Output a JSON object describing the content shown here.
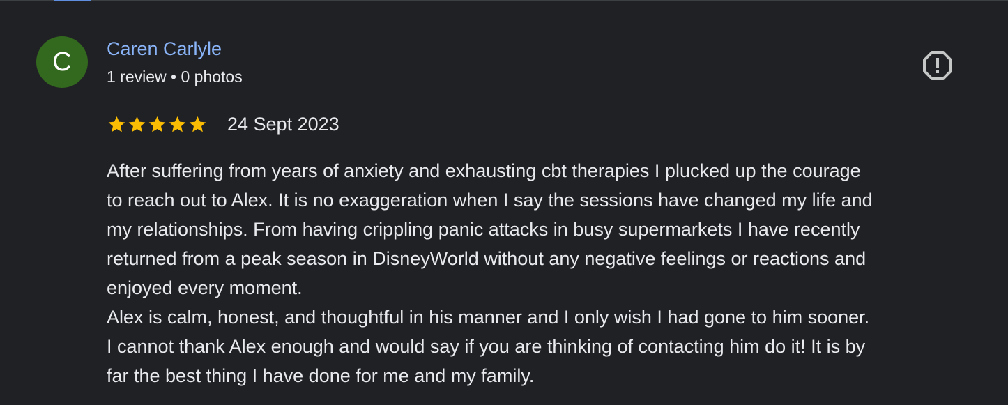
{
  "reviewer": {
    "initial": "C",
    "name": "Caren Carlyle",
    "meta": "1 review • 0 photos",
    "avatar_color": "#33691e"
  },
  "review": {
    "rating": 5,
    "max_rating": 5,
    "date": "24 Sept 2023",
    "lines": [
      "After suffering from years of anxiety and exhausting cbt therapies I plucked up the courage",
      "to reach out to Alex. It is no exaggeration when I say the sessions have changed my life and",
      "my relationships. From having crippling panic attacks in busy supermarkets I have recently",
      "returned from a peak season in DisneyWorld without any negative feelings or reactions and",
      "enjoyed every moment.",
      "Alex is calm, honest, and thoughtful in his manner and I only wish I had gone to him sooner.",
      "I cannot thank Alex enough and would say if you are thinking of contacting him do it! It is by",
      "far the best thing I have done for me and my family."
    ]
  },
  "icons": {
    "report": "report-icon",
    "star": "star-icon"
  },
  "colors": {
    "background": "#202124",
    "name_link": "#8ab4f8",
    "star": "#fbbc04",
    "text": "#e8eaed",
    "icon": "#c4c7c5"
  }
}
